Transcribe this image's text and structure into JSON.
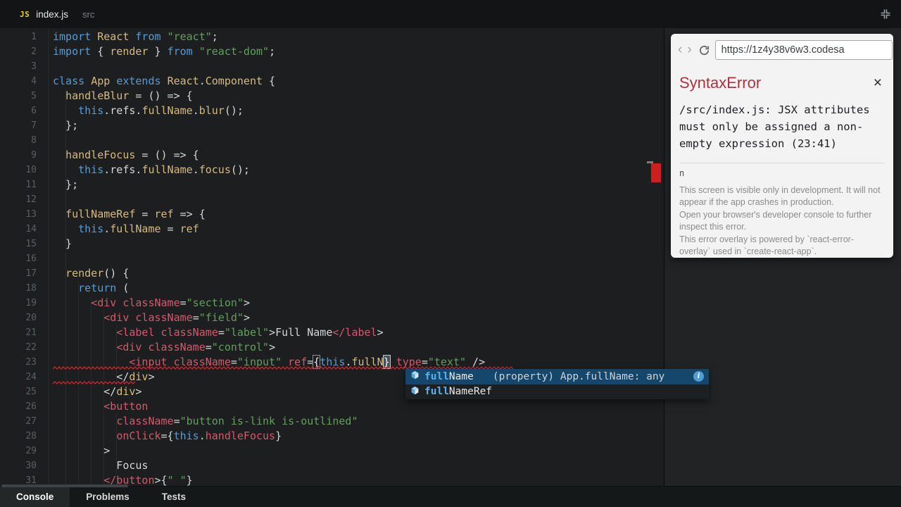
{
  "topbar": {
    "badge": "JS",
    "file_name": "index.js",
    "folder": "src"
  },
  "editor": {
    "lines": [
      [
        1,
        [
          [
            "kw",
            "import"
          ],
          [
            "pl",
            " "
          ],
          [
            "id",
            "React"
          ],
          [
            "pl",
            " "
          ],
          [
            "kw",
            "from"
          ],
          [
            "pl",
            " "
          ],
          [
            "str",
            "\"react\""
          ],
          [
            "pl",
            ";"
          ]
        ]
      ],
      [
        2,
        [
          [
            "kw",
            "import"
          ],
          [
            "pl",
            " { "
          ],
          [
            "id",
            "render"
          ],
          [
            "pl",
            " } "
          ],
          [
            "kw",
            "from"
          ],
          [
            "pl",
            " "
          ],
          [
            "str",
            "\"react-dom\""
          ],
          [
            "pl",
            ";"
          ]
        ]
      ],
      [
        3,
        []
      ],
      [
        4,
        [
          [
            "kw",
            "class"
          ],
          [
            "pl",
            " "
          ],
          [
            "id",
            "App"
          ],
          [
            "pl",
            " "
          ],
          [
            "kw",
            "extends"
          ],
          [
            "pl",
            " "
          ],
          [
            "id",
            "React"
          ],
          [
            "pl",
            "."
          ],
          [
            "id",
            "Component"
          ],
          [
            "pl",
            " {"
          ]
        ]
      ],
      [
        5,
        [
          [
            "pl",
            "  "
          ],
          [
            "id",
            "handleBlur"
          ],
          [
            "pl",
            " = () => {"
          ]
        ]
      ],
      [
        6,
        [
          [
            "pl",
            "    "
          ],
          [
            "kw",
            "this"
          ],
          [
            "pl",
            ".refs."
          ],
          [
            "id",
            "fullName"
          ],
          [
            "pl",
            "."
          ],
          [
            "id",
            "blur"
          ],
          [
            "pl",
            "();"
          ]
        ]
      ],
      [
        7,
        [
          [
            "pl",
            "  };"
          ]
        ]
      ],
      [
        8,
        []
      ],
      [
        9,
        [
          [
            "pl",
            "  "
          ],
          [
            "id",
            "handleFocus"
          ],
          [
            "pl",
            " = () => {"
          ]
        ]
      ],
      [
        10,
        [
          [
            "pl",
            "    "
          ],
          [
            "kw",
            "this"
          ],
          [
            "pl",
            ".refs."
          ],
          [
            "id",
            "fullName"
          ],
          [
            "pl",
            "."
          ],
          [
            "id",
            "focus"
          ],
          [
            "pl",
            "();"
          ]
        ]
      ],
      [
        11,
        [
          [
            "pl",
            "  };"
          ]
        ]
      ],
      [
        12,
        []
      ],
      [
        13,
        [
          [
            "pl",
            "  "
          ],
          [
            "id",
            "fullNameRef"
          ],
          [
            "pl",
            " = "
          ],
          [
            "id",
            "ref"
          ],
          [
            "pl",
            " => {"
          ]
        ]
      ],
      [
        14,
        [
          [
            "pl",
            "    "
          ],
          [
            "kw",
            "this"
          ],
          [
            "pl",
            "."
          ],
          [
            "id",
            "fullName"
          ],
          [
            "pl",
            " = "
          ],
          [
            "id",
            "ref"
          ]
        ]
      ],
      [
        15,
        [
          [
            "pl",
            "  }"
          ]
        ]
      ],
      [
        16,
        []
      ],
      [
        17,
        [
          [
            "pl",
            "  "
          ],
          [
            "id",
            "render"
          ],
          [
            "pl",
            "() {"
          ]
        ]
      ],
      [
        18,
        [
          [
            "pl",
            "    "
          ],
          [
            "kw",
            "return"
          ],
          [
            "pl",
            " ("
          ]
        ]
      ],
      [
        19,
        [
          [
            "pl",
            "      "
          ],
          [
            "tag",
            "<div"
          ],
          [
            "pl",
            " "
          ],
          [
            "tag",
            "className"
          ],
          [
            "pl",
            "="
          ],
          [
            "str",
            "\"section\""
          ],
          [
            "pl",
            ">"
          ]
        ]
      ],
      [
        20,
        [
          [
            "pl",
            "        "
          ],
          [
            "tag",
            "<div"
          ],
          [
            "pl",
            " "
          ],
          [
            "tag",
            "className"
          ],
          [
            "pl",
            "="
          ],
          [
            "str",
            "\"field\""
          ],
          [
            "pl",
            ">"
          ]
        ]
      ],
      [
        21,
        [
          [
            "pl",
            "          "
          ],
          [
            "tag",
            "<label"
          ],
          [
            "pl",
            " "
          ],
          [
            "tag",
            "className"
          ],
          [
            "pl",
            "="
          ],
          [
            "str",
            "\"label\""
          ],
          [
            "pl",
            ">"
          ],
          [
            "pl",
            "Full Name"
          ],
          [
            "tag",
            "</label"
          ],
          [
            "pl",
            ">"
          ]
        ]
      ],
      [
        22,
        [
          [
            "pl",
            "          "
          ],
          [
            "tag",
            "<div"
          ],
          [
            "pl",
            " "
          ],
          [
            "tag",
            "className"
          ],
          [
            "pl",
            "="
          ],
          [
            "str",
            "\"control\""
          ],
          [
            "pl",
            ">"
          ]
        ]
      ],
      [
        23,
        [
          [
            "pl",
            "            "
          ],
          [
            "tag",
            "<input"
          ],
          [
            "pl",
            " "
          ],
          [
            "tag",
            "className"
          ],
          [
            "pl",
            "="
          ],
          [
            "str",
            "\"input\""
          ],
          [
            "pl",
            " "
          ],
          [
            "tag",
            "ref"
          ],
          [
            "pl",
            "="
          ],
          [
            "brk",
            "{"
          ],
          [
            "kw",
            "this"
          ],
          [
            "pl",
            "."
          ],
          [
            "id",
            "fullN"
          ],
          [
            "brk2",
            "}"
          ],
          [
            "pl",
            " "
          ],
          [
            "tag",
            "type"
          ],
          [
            "pl",
            "="
          ],
          [
            "str",
            "\"text\""
          ],
          [
            "pl",
            " />"
          ]
        ]
      ],
      [
        24,
        [
          [
            "pl",
            "          </"
          ],
          [
            "id",
            "div"
          ],
          [
            "pl",
            ">"
          ]
        ]
      ],
      [
        25,
        [
          [
            "pl",
            "        </"
          ],
          [
            "id",
            "div"
          ],
          [
            "pl",
            ">"
          ]
        ]
      ],
      [
        26,
        [
          [
            "pl",
            "        "
          ],
          [
            "tag",
            "<button"
          ]
        ]
      ],
      [
        27,
        [
          [
            "pl",
            "          "
          ],
          [
            "tag",
            "className"
          ],
          [
            "pl",
            "="
          ],
          [
            "str",
            "\"button is-link is-outlined\""
          ]
        ]
      ],
      [
        28,
        [
          [
            "pl",
            "          "
          ],
          [
            "tag",
            "onClick"
          ],
          [
            "pl",
            "={"
          ],
          [
            "kw",
            "this"
          ],
          [
            "pl",
            "."
          ],
          [
            "tag",
            "handleFocus"
          ],
          [
            "pl",
            "}"
          ]
        ]
      ],
      [
        29,
        [
          [
            "pl",
            "        >"
          ]
        ]
      ],
      [
        30,
        [
          [
            "pl",
            "          Focus"
          ]
        ]
      ],
      [
        31,
        [
          [
            "pl",
            "        "
          ],
          [
            "tag",
            "</button"
          ],
          [
            "pl",
            ">{"
          ],
          [
            "str",
            "\" \""
          ],
          [
            "pl",
            "}"
          ]
        ]
      ]
    ]
  },
  "autocomplete": {
    "items": [
      {
        "match": "full",
        "rest": "Name",
        "detail": "(property) App.fullName: any",
        "info": "i",
        "selected": true
      },
      {
        "match": "full",
        "rest": "NameRef",
        "detail": "",
        "selected": false
      }
    ]
  },
  "preview": {
    "url": "https://1z4y38v6w3.codesa",
    "error": {
      "title": "SyntaxError",
      "close": "×",
      "message": "/src/index.js: JSX attributes must only be assigned a non-empty expression (23:41)",
      "fragment": "n",
      "notes": [
        "This screen is visible only in development. It will not appear if the app crashes in production.",
        "Open your browser's developer console to further inspect this error.",
        "This error overlay is powered by `react-error-overlay` used in `create-react-app`."
      ]
    }
  },
  "bottombar": {
    "tabs": [
      {
        "label": "Console",
        "active": true
      },
      {
        "label": "Problems",
        "active": false
      },
      {
        "label": "Tests",
        "active": false
      }
    ]
  },
  "colors": {
    "keyword": "#559cd6",
    "identifier": "#d7ba7d",
    "string": "#62a05c",
    "jsx_tag": "#d5596d",
    "error_title": "#b0303f",
    "squiggle": "#e5252f",
    "selection_blue": "#15466b",
    "scroll_error_marker": "#cd1f1f",
    "badge_yellow": "#e8d42c"
  }
}
